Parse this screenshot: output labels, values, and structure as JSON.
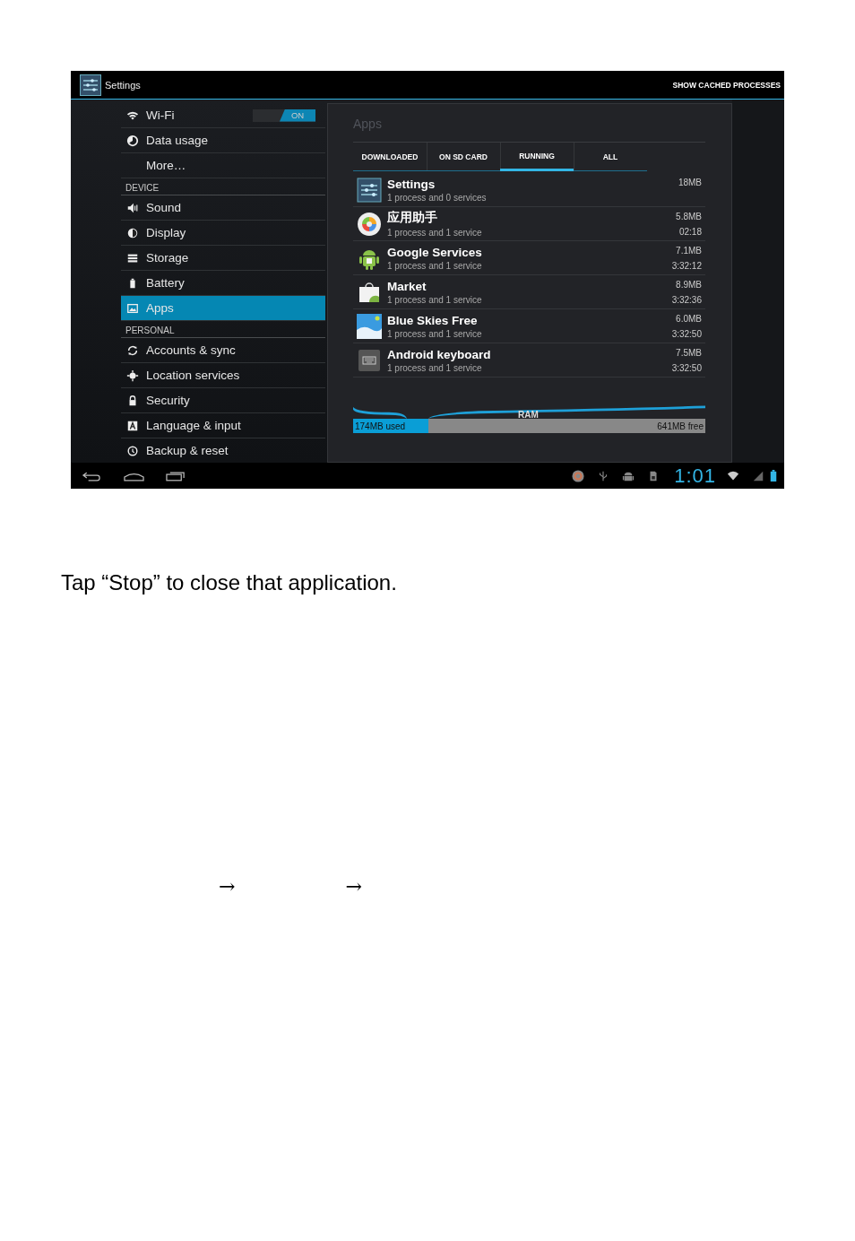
{
  "window": {
    "title": "Settings",
    "menu_action": "SHOW CACHED PROCESSES"
  },
  "sidebar": {
    "items": [
      {
        "kind": "item",
        "label": "Wi-Fi",
        "selected": false,
        "toggle": {
          "label": "ON",
          "on": true
        }
      },
      {
        "kind": "item",
        "label": "Data usage",
        "selected": false
      },
      {
        "kind": "item",
        "label": "More…",
        "selected": false
      },
      {
        "kind": "header",
        "label": "DEVICE"
      },
      {
        "kind": "item",
        "label": "Sound",
        "selected": false
      },
      {
        "kind": "item",
        "label": "Display",
        "selected": false
      },
      {
        "kind": "item",
        "label": "Storage",
        "selected": false
      },
      {
        "kind": "item",
        "label": "Battery",
        "selected": false
      },
      {
        "kind": "item",
        "label": "Apps",
        "selected": true
      },
      {
        "kind": "header",
        "label": "PERSONAL"
      },
      {
        "kind": "item",
        "label": "Accounts & sync",
        "selected": false
      },
      {
        "kind": "item",
        "label": "Location services",
        "selected": false
      },
      {
        "kind": "item",
        "label": "Security",
        "selected": false
      },
      {
        "kind": "item",
        "label": "Language & input",
        "selected": false
      },
      {
        "kind": "item",
        "label": "Backup & reset",
        "selected": false
      }
    ]
  },
  "panel": {
    "title": "Apps",
    "tabs": [
      {
        "label": "DOWNLOADED",
        "selected": false
      },
      {
        "label": "ON SD CARD",
        "selected": false
      },
      {
        "label": "RUNNING",
        "selected": true
      },
      {
        "label": "ALL",
        "selected": false
      }
    ],
    "processes": [
      {
        "name": "Settings",
        "detail": "1 process and 0 services",
        "size": "18MB"
      },
      {
        "name": "应用助手",
        "detail": "1 process and 1 service",
        "size": "5.8MB",
        "time": "02:18"
      },
      {
        "name": "Google Services",
        "detail": "1 process and 1 service",
        "size": "7.1MB",
        "time": "3:32:12"
      },
      {
        "name": "Market",
        "detail": "1 process and 1 service",
        "size": "8.9MB",
        "time": "3:32:36"
      },
      {
        "name": "Blue Skies Free",
        "detail": "1 process and 1 service",
        "size": "6.0MB",
        "time": "3:32:50"
      },
      {
        "name": "Android keyboard",
        "detail": "1 process and 1 service",
        "size": "7.5MB",
        "time": "3:32:50"
      }
    ],
    "memory": {
      "label": "RAM",
      "used": "174MB used",
      "free": "641MB free",
      "level": 0.2135
    }
  },
  "status_bar": {
    "clock": "1:01"
  },
  "instruction": "Tap “Stop” to close that application.",
  "arrows": [
    "→",
    "→"
  ]
}
